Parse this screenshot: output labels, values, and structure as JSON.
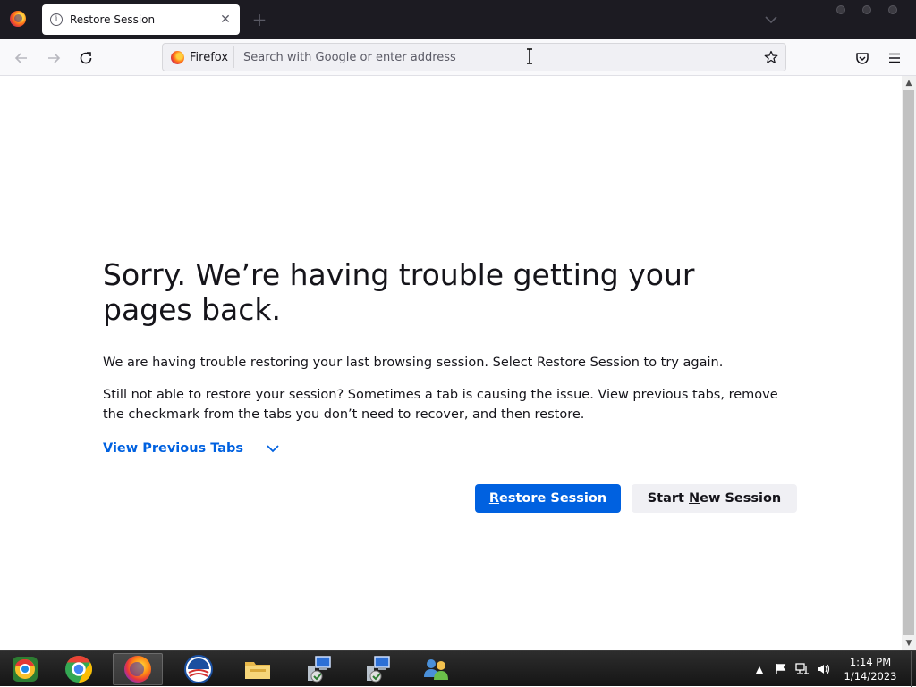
{
  "browser": {
    "tab": {
      "title": "Restore Session",
      "info_icon": "info-icon",
      "close_glyph": "✕"
    },
    "new_tab_glyph": "+",
    "identity_label": "Firefox",
    "url_placeholder": "Search with Google or enter address"
  },
  "page": {
    "title": "Sorry. We’re having trouble getting your pages back.",
    "para1": "We are having trouble restoring your last browsing session. Select Restore Session to try again.",
    "para2": "Still not able to restore your session? Sometimes a tab is causing the issue. View previous tabs, remove the checkmark from the tabs you don’t need to recover, and then restore.",
    "view_previous_label": "View Previous Tabs",
    "restore_button": {
      "label": "Restore Session",
      "accesskey": "R"
    },
    "new_session_button": {
      "label": "Start New Session",
      "accesskey": "N"
    }
  },
  "taskbar": {
    "items": [
      {
        "name": "chrome-canary-icon"
      },
      {
        "name": "chrome-icon"
      },
      {
        "name": "firefox-icon",
        "active": true
      },
      {
        "name": "obama-logo-icon"
      },
      {
        "name": "file-explorer-icon"
      },
      {
        "name": "network-install-icon-1"
      },
      {
        "name": "network-install-icon-2"
      },
      {
        "name": "users-icon"
      }
    ],
    "clock": {
      "time": "1:14 PM",
      "date": "1/14/2023"
    }
  },
  "colors": {
    "accent": "#0061e0",
    "titlebar": "#1c1b22",
    "toolbar": "#f9f9fb",
    "text": "#15141a"
  }
}
